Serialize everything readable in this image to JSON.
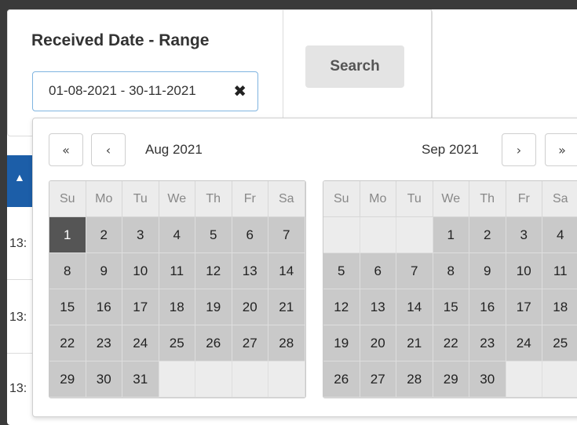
{
  "filter": {
    "range_label": "Received Date - Range",
    "range_value": "01-08-2021 - 30-11-2021",
    "clear_glyph": "✖",
    "search_label": "Search"
  },
  "table": {
    "rows": [
      "13:",
      "13:",
      "13:"
    ]
  },
  "picker": {
    "nav": {
      "first": "«",
      "prev": "‹",
      "next": "›",
      "last": "»"
    },
    "weekdays": [
      "Su",
      "Mo",
      "Tu",
      "We",
      "Th",
      "Fr",
      "Sa"
    ],
    "left": {
      "title": "Aug 2021",
      "lead_blank": 0,
      "days": [
        "1",
        "2",
        "3",
        "4",
        "5",
        "6",
        "7",
        "8",
        "9",
        "10",
        "11",
        "12",
        "13",
        "14",
        "15",
        "16",
        "17",
        "18",
        "19",
        "20",
        "21",
        "22",
        "23",
        "24",
        "25",
        "26",
        "27",
        "28",
        "29",
        "30",
        "31"
      ],
      "selected": "1"
    },
    "right": {
      "title": "Sep 2021",
      "lead_blank": 3,
      "days": [
        "1",
        "2",
        "3",
        "4",
        "5",
        "6",
        "7",
        "8",
        "9",
        "10",
        "11",
        "12",
        "13",
        "14",
        "15",
        "16",
        "17",
        "18",
        "19",
        "20",
        "21",
        "22",
        "23",
        "24",
        "25",
        "26",
        "27",
        "28",
        "29",
        "30"
      ],
      "selected": ""
    }
  },
  "colors": {
    "accent": "#1c5ea8",
    "selected_day": "#555555",
    "range_day": "#c9c9c9"
  }
}
